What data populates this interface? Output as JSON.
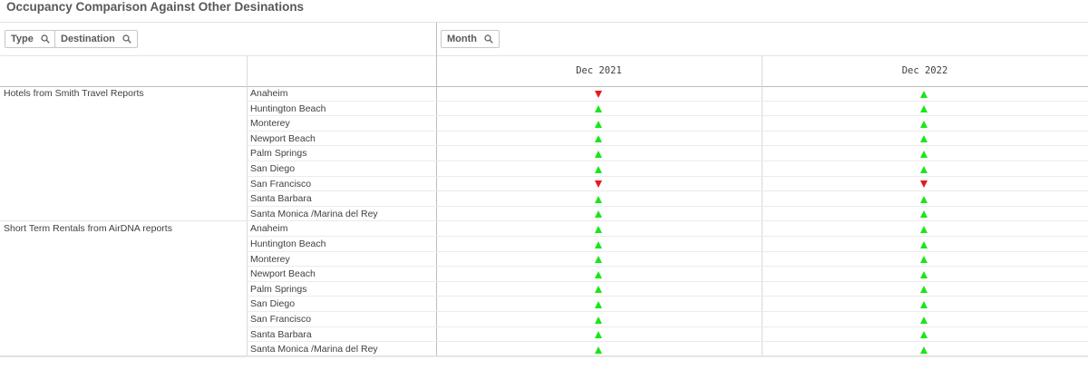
{
  "title": "Occupancy Comparison Against Other Desinations",
  "filters": {
    "type": "Type",
    "destination": "Destination",
    "month": "Month"
  },
  "columns": [
    "Dec 2021",
    "Dec 2022"
  ],
  "colors": {
    "up": "#19e619",
    "down": "#e61919"
  },
  "groups": [
    {
      "label": "Hotels from Smith Travel Reports",
      "rows": [
        {
          "destination": "Anaheim",
          "dec2021": "down",
          "dec2022": "up"
        },
        {
          "destination": "Huntington Beach",
          "dec2021": "up",
          "dec2022": "up"
        },
        {
          "destination": "Monterey",
          "dec2021": "up",
          "dec2022": "up"
        },
        {
          "destination": "Newport Beach",
          "dec2021": "up",
          "dec2022": "up"
        },
        {
          "destination": "Palm Springs",
          "dec2021": "up",
          "dec2022": "up"
        },
        {
          "destination": "San Diego",
          "dec2021": "up",
          "dec2022": "up"
        },
        {
          "destination": "San Francisco",
          "dec2021": "down",
          "dec2022": "down"
        },
        {
          "destination": "Santa Barbara",
          "dec2021": "up",
          "dec2022": "up"
        },
        {
          "destination": "Santa Monica /Marina del Rey",
          "dec2021": "up",
          "dec2022": "up"
        }
      ]
    },
    {
      "label": "Short Term Rentals from AirDNA reports",
      "rows": [
        {
          "destination": "Anaheim",
          "dec2021": "up",
          "dec2022": "up"
        },
        {
          "destination": "Huntington Beach",
          "dec2021": "up",
          "dec2022": "up"
        },
        {
          "destination": "Monterey",
          "dec2021": "up",
          "dec2022": "up"
        },
        {
          "destination": "Newport Beach",
          "dec2021": "up",
          "dec2022": "up"
        },
        {
          "destination": "Palm Springs",
          "dec2021": "up",
          "dec2022": "up"
        },
        {
          "destination": "San Diego",
          "dec2021": "up",
          "dec2022": "up"
        },
        {
          "destination": "San Francisco",
          "dec2021": "up",
          "dec2022": "up"
        },
        {
          "destination": "Santa Barbara",
          "dec2021": "up",
          "dec2022": "up"
        },
        {
          "destination": "Santa Monica /Marina del Rey",
          "dec2021": "up",
          "dec2022": "up"
        }
      ]
    }
  ]
}
